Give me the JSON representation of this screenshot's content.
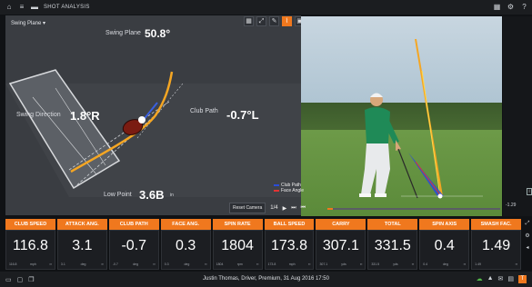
{
  "titlebar": {
    "title": "SHOT ANALYSIS"
  },
  "scene": {
    "view_select": "Swing Plane",
    "swing_plane": {
      "label": "Swing Plane",
      "value": "50.8°"
    },
    "swing_direction": {
      "label": "Swing Direction",
      "value": "1.8°R"
    },
    "club_path": {
      "label": "Club Path",
      "value": "-0.7°L"
    },
    "low_point": {
      "label": "Low Point",
      "value": "3.6B",
      "unit": "in"
    }
  },
  "video": {
    "legend": [
      {
        "name": "Club Path",
        "color": "#2a4cd8"
      },
      {
        "name": "Face Angle",
        "color": "#e03434"
      }
    ],
    "reset_label": "Reset Camera",
    "speed": "1/4",
    "time_right": "-1.29"
  },
  "metrics": [
    {
      "label": "CLUB SPEED",
      "value": "116.8",
      "unit": "mph"
    },
    {
      "label": "ATTACK ANG.",
      "value": "3.1",
      "unit": "deg"
    },
    {
      "label": "CLUB PATH",
      "value": "-0.7",
      "unit": "deg"
    },
    {
      "label": "FACE ANG.",
      "value": "0.3",
      "unit": "deg"
    },
    {
      "label": "SPIN RATE",
      "value": "1804",
      "unit": "rpm"
    },
    {
      "label": "BALL SPEED",
      "value": "173.8",
      "unit": "mph"
    },
    {
      "label": "CARRY",
      "value": "307.1",
      "unit": "yds"
    },
    {
      "label": "TOTAL",
      "value": "331.5",
      "unit": "yds"
    },
    {
      "label": "SPIN AXIS",
      "value": "0.4",
      "unit": "deg"
    },
    {
      "label": "SMASH FAC.",
      "value": "1.49",
      "unit": ""
    }
  ],
  "footer": {
    "session": "Justin Thomas, Driver, Premium, 31 Aug 2016 17:50"
  },
  "colors": {
    "accent": "#f0781e",
    "swing_curve": "#f5a623",
    "ball_line": "#3a5fe0"
  }
}
